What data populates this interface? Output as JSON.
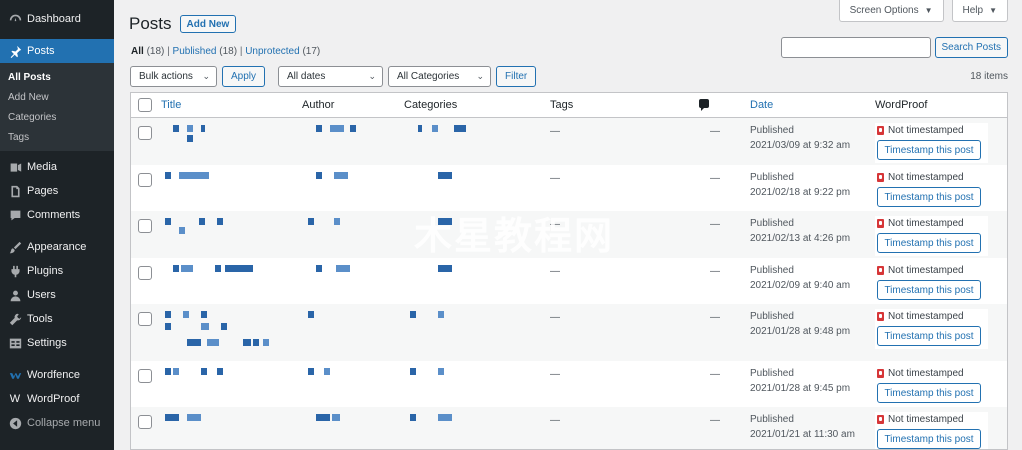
{
  "sidebar": {
    "items": [
      {
        "label": "Dashboard",
        "icon": "dashboard-icon"
      },
      {
        "label": "Posts",
        "icon": "pin-icon",
        "active": true
      },
      {
        "label": "Media",
        "icon": "media-icon"
      },
      {
        "label": "Pages",
        "icon": "pages-icon"
      },
      {
        "label": "Comments",
        "icon": "comments-icon"
      },
      {
        "label": "Appearance",
        "icon": "appearance-icon"
      },
      {
        "label": "Plugins",
        "icon": "plugins-icon"
      },
      {
        "label": "Users",
        "icon": "users-icon"
      },
      {
        "label": "Tools",
        "icon": "tools-icon"
      },
      {
        "label": "Settings",
        "icon": "settings-icon"
      },
      {
        "label": "Wordfence",
        "icon": "wordfence-icon"
      },
      {
        "label": "WordProof",
        "icon": "wordproof-icon"
      },
      {
        "label": "Collapse menu",
        "icon": "collapse-icon"
      }
    ],
    "posts_submenu": [
      "All Posts",
      "Add New",
      "Categories",
      "Tags"
    ]
  },
  "header": {
    "screen_options": "Screen Options",
    "help": "Help",
    "title": "Posts",
    "add_new": "Add New"
  },
  "views": {
    "all": "All",
    "all_count": "(18)",
    "published": "Published",
    "published_count": "(18)",
    "unprotected": "Unprotected",
    "unprotected_count": "(17)",
    "sep": "|"
  },
  "search": {
    "button": "Search Posts",
    "value": ""
  },
  "tablenav": {
    "bulk_actions": "Bulk actions",
    "apply": "Apply",
    "all_dates": "All dates",
    "all_categories": "All Categories",
    "filter": "Filter",
    "items": "18 items"
  },
  "table": {
    "headers": {
      "title": "Title",
      "author": "Author",
      "categories": "Categories",
      "tags": "Tags",
      "date": "Date",
      "wordproof": "WordProof"
    },
    "rows": [
      {
        "tags": "—",
        "comments": "—",
        "status": "Published",
        "date": "2021/03/09 at 9:32 am",
        "wp_status": "Not timestamped",
        "wp_button": "Timestamp this post"
      },
      {
        "tags": "—",
        "comments": "—",
        "status": "Published",
        "date": "2021/02/18 at 9:22 pm",
        "wp_status": "Not timestamped",
        "wp_button": "Timestamp this post"
      },
      {
        "tags": "—",
        "comments": "—",
        "status": "Published",
        "date": "2021/02/13 at 4:26 pm",
        "wp_status": "Not timestamped",
        "wp_button": "Timestamp this post"
      },
      {
        "tags": "—",
        "comments": "—",
        "status": "Published",
        "date": "2021/02/09 at 9:40 am",
        "wp_status": "Not timestamped",
        "wp_button": "Timestamp this post"
      },
      {
        "tags": "—",
        "comments": "—",
        "status": "Published",
        "date": "2021/01/28 at 9:48 pm",
        "wp_status": "Not timestamped",
        "wp_button": "Timestamp this post"
      },
      {
        "tags": "—",
        "comments": "—",
        "status": "Published",
        "date": "2021/01/28 at 9:45 pm",
        "wp_status": "Not timestamped",
        "wp_button": "Timestamp this post"
      },
      {
        "tags": "—",
        "comments": "—",
        "status": "Published",
        "date": "2021/01/21 at 11:30 am",
        "wp_status": "Not timestamped",
        "wp_button": "Timestamp this post"
      }
    ]
  },
  "watermark": "木星教程网",
  "colors": {
    "accent": "#2271b1",
    "sidebar_bg": "#1d2327",
    "lock": "#d63638"
  }
}
